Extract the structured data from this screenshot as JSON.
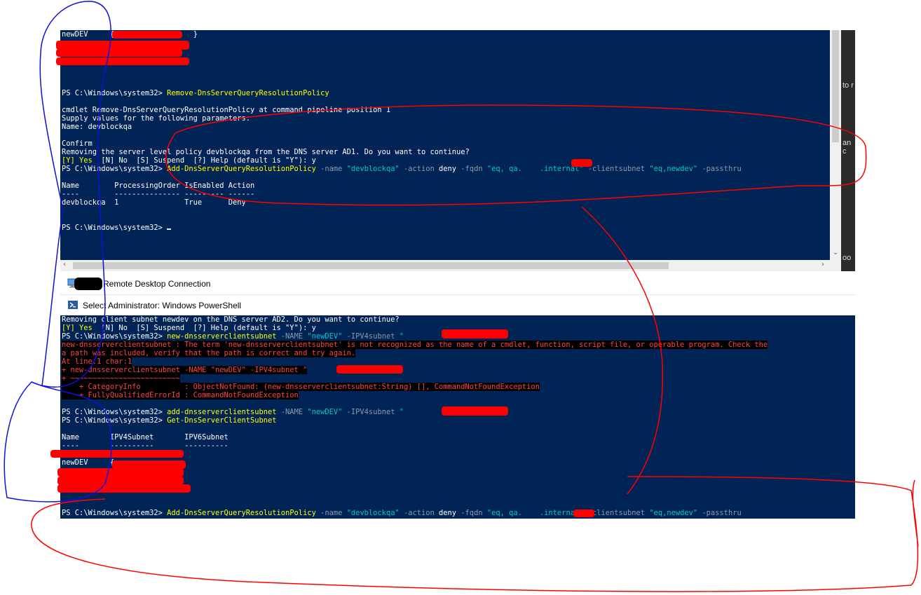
{
  "top_terminal": {
    "lines": [
      {
        "parts": [
          {
            "t": "newDEV     {",
            "c": "w"
          },
          {
            "t": "                  ",
            "c": "w"
          },
          {
            "t": "}",
            "c": "w"
          }
        ]
      },
      {
        "parts": [
          {
            "t": "",
            "c": "w"
          }
        ]
      },
      {
        "parts": [
          {
            "t": "",
            "c": "w"
          }
        ]
      },
      {
        "parts": [
          {
            "t": "",
            "c": "w"
          }
        ]
      },
      {
        "parts": [
          {
            "t": "",
            "c": "w"
          }
        ]
      },
      {
        "parts": [
          {
            "t": "",
            "c": "w"
          }
        ]
      },
      {
        "parts": [
          {
            "t": "",
            "c": "w"
          }
        ]
      },
      {
        "parts": [
          {
            "t": "PS C:\\Windows\\system32> ",
            "c": "w"
          },
          {
            "t": "Remove-DnsServerQueryResolutionPolicy",
            "c": "y"
          }
        ]
      },
      {
        "parts": [
          {
            "t": "",
            "c": "w"
          }
        ]
      },
      {
        "parts": [
          {
            "t": "cmdlet Remove-DnsServerQueryResolutionPolicy at command pipeline position 1",
            "c": "w"
          }
        ]
      },
      {
        "parts": [
          {
            "t": "Supply values for the following parameters:",
            "c": "w"
          }
        ]
      },
      {
        "parts": [
          {
            "t": "Name: devblockqa",
            "c": "w"
          }
        ]
      },
      {
        "parts": [
          {
            "t": "",
            "c": "w"
          }
        ]
      },
      {
        "parts": [
          {
            "t": "Confirm",
            "c": "w"
          }
        ]
      },
      {
        "parts": [
          {
            "t": "Removing the server level policy devblockqa from the DNS server AD1. Do you want to continue?",
            "c": "w"
          }
        ]
      },
      {
        "parts": [
          {
            "t": "[Y] Yes  ",
            "c": "y"
          },
          {
            "t": "[N] No  [S] Suspend  [?] Help (default is \"Y\"): y",
            "c": "w"
          }
        ]
      },
      {
        "parts": [
          {
            "t": "PS C:\\Windows\\system32> ",
            "c": "w"
          },
          {
            "t": "Add-DnsServerQueryResolutionPolicy ",
            "c": "y"
          },
          {
            "t": "-name ",
            "c": "g"
          },
          {
            "t": "\"devblockqa\" ",
            "c": "c"
          },
          {
            "t": "-action ",
            "c": "g"
          },
          {
            "t": "deny ",
            "c": "w"
          },
          {
            "t": "-fqdn ",
            "c": "g"
          },
          {
            "t": "\"eq, qa.    .internal\" ",
            "c": "c"
          },
          {
            "t": "-clientsubnet ",
            "c": "g"
          },
          {
            "t": "\"eq,newdev\" ",
            "c": "c"
          },
          {
            "t": "-passthru",
            "c": "g"
          }
        ]
      },
      {
        "parts": [
          {
            "t": "",
            "c": "w"
          }
        ]
      },
      {
        "parts": [
          {
            "t": "Name        ProcessingOrder IsEnabled Action",
            "c": "w"
          }
        ]
      },
      {
        "parts": [
          {
            "t": "----        --------------- --------- ------",
            "c": "w"
          }
        ]
      },
      {
        "parts": [
          {
            "t": "devblockqa  1               True      Deny",
            "c": "w"
          }
        ]
      },
      {
        "parts": [
          {
            "t": "",
            "c": "w"
          }
        ]
      },
      {
        "parts": [
          {
            "t": "",
            "c": "w"
          }
        ]
      },
      {
        "parts": [
          {
            "t": "PS C:\\Windows\\system32> ",
            "c": "w"
          }
        ]
      }
    ]
  },
  "rdp_bar": {
    "title": "Remote Desktop Connection"
  },
  "ps_bar": {
    "title": "Select Administrator: Windows PowerShell"
  },
  "bottom_terminal": {
    "lines": [
      {
        "parts": [
          {
            "t": "Removing client subnet newdev on the DNS server AD2. Do you want to continue?",
            "c": "w"
          }
        ]
      },
      {
        "parts": [
          {
            "t": "[Y] Yes  ",
            "c": "y"
          },
          {
            "t": "[N] No  [S] Suspend  [?] Help (default is \"Y\"): y",
            "c": "w"
          }
        ]
      },
      {
        "parts": [
          {
            "t": "PS C:\\Windows\\system32> ",
            "c": "w"
          },
          {
            "t": "new-dnsserverclientsubnet ",
            "c": "y"
          },
          {
            "t": "-NAME ",
            "c": "g"
          },
          {
            "t": "\"newDEV\" ",
            "c": "c"
          },
          {
            "t": "-IPV4subnet ",
            "c": "g"
          },
          {
            "t": "\"",
            "c": "c"
          }
        ]
      },
      {
        "parts": [
          {
            "t": "new-dnsserverclientsubnet : The term 'new-dnsserverclientsubnet' is not recognized as the name of a cmdlet, function, script file, or operable program. Check the",
            "c": "err"
          }
        ]
      },
      {
        "parts": [
          {
            "t": "a path was included, verify that the path is correct and try again.",
            "c": "err"
          }
        ]
      },
      {
        "parts": [
          {
            "t": "At line:1 char:1",
            "c": "err"
          }
        ]
      },
      {
        "parts": [
          {
            "t": "+ new-dnsserverclientsubnet -NAME \"newDEV\" -IPV4subnet \"",
            "c": "err"
          }
        ]
      },
      {
        "parts": [
          {
            "t": "+ ~~~~~~~~~~~~~~~~~~~~~~~~~",
            "c": "err"
          }
        ]
      },
      {
        "parts": [
          {
            "t": "    + CategoryInfo          : ObjectNotFound: (new-dnsserverclientsubnet:String) [], CommandNotFoundException",
            "c": "err"
          }
        ]
      },
      {
        "parts": [
          {
            "t": "    + FullyQualifiedErrorId : CommandNotFoundException",
            "c": "err"
          }
        ]
      },
      {
        "parts": [
          {
            "t": "",
            "c": "w"
          }
        ]
      },
      {
        "parts": [
          {
            "t": "PS C:\\Windows\\system32> ",
            "c": "w"
          },
          {
            "t": "add-dnsserverclientsubnet ",
            "c": "y"
          },
          {
            "t": "-NAME ",
            "c": "g"
          },
          {
            "t": "\"newDEV\" ",
            "c": "c"
          },
          {
            "t": "-IPV4subnet ",
            "c": "g"
          },
          {
            "t": "\"",
            "c": "c"
          }
        ]
      },
      {
        "parts": [
          {
            "t": "PS C:\\Windows\\system32> ",
            "c": "w"
          },
          {
            "t": "Get-DnsServerClientSubnet",
            "c": "y"
          }
        ]
      },
      {
        "parts": [
          {
            "t": "",
            "c": "w"
          }
        ]
      },
      {
        "parts": [
          {
            "t": "Name       IPV4Subnet       IPV6Subnet",
            "c": "w"
          }
        ]
      },
      {
        "parts": [
          {
            "t": "----       ----------       ----------",
            "c": "w"
          }
        ]
      },
      {
        "parts": [
          {
            "t": "",
            "c": "w"
          }
        ]
      },
      {
        "parts": [
          {
            "t": "newDEV     {",
            "c": "w"
          }
        ]
      },
      {
        "parts": [
          {
            "t": "",
            "c": "w"
          }
        ]
      },
      {
        "parts": [
          {
            "t": "",
            "c": "w"
          }
        ]
      },
      {
        "parts": [
          {
            "t": "",
            "c": "w"
          }
        ]
      },
      {
        "parts": [
          {
            "t": "",
            "c": "w"
          }
        ]
      },
      {
        "parts": [
          {
            "t": "",
            "c": "w"
          }
        ]
      },
      {
        "parts": [
          {
            "t": "PS C:\\Windows\\system32> ",
            "c": "w"
          },
          {
            "t": "Add-DnsServerQueryResolutionPolicy ",
            "c": "y"
          },
          {
            "t": "-name ",
            "c": "g"
          },
          {
            "t": "\"devblockqa\" ",
            "c": "c"
          },
          {
            "t": "-action ",
            "c": "g"
          },
          {
            "t": "deny ",
            "c": "w"
          },
          {
            "t": "-fqdn ",
            "c": "g"
          },
          {
            "t": "\"eq, qa.    .internal\" ",
            "c": "c"
          },
          {
            "t": "-clientsubnet ",
            "c": "g"
          },
          {
            "t": "\"eq,newdev\" ",
            "c": "c"
          },
          {
            "t": "-passthru",
            "c": "g"
          }
        ]
      }
    ]
  },
  "right_strip": {
    "texts": [
      "to r",
      "an c",
      "oo"
    ]
  },
  "colors": {
    "terminal_bg": "#012456",
    "annotation_red": "#ff0000",
    "annotation_blue": "#1010e0"
  }
}
